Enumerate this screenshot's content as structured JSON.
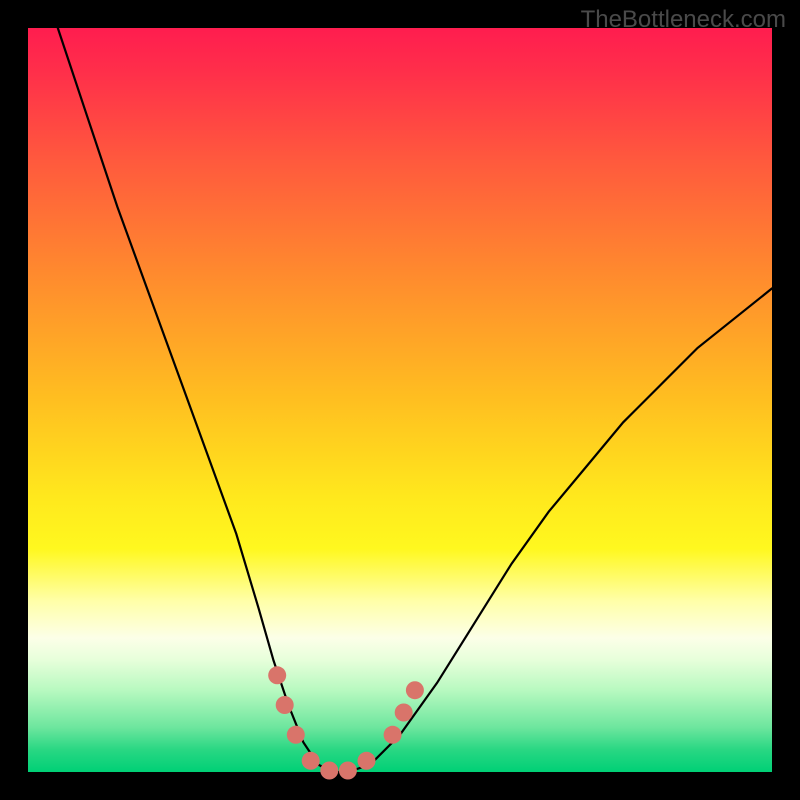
{
  "watermark": "TheBottleneck.com",
  "chart_data": {
    "type": "line",
    "title": "",
    "xlabel": "",
    "ylabel": "",
    "xlim": [
      0,
      100
    ],
    "ylim": [
      0,
      100
    ],
    "series": [
      {
        "name": "curve",
        "x": [
          4,
          8,
          12,
          16,
          20,
          24,
          28,
          31,
          33,
          35,
          37,
          39,
          41,
          43,
          46,
          50,
          55,
          60,
          65,
          70,
          75,
          80,
          85,
          90,
          95,
          100
        ],
        "y": [
          100,
          88,
          76,
          65,
          54,
          43,
          32,
          22,
          15,
          9,
          4,
          1,
          0,
          0,
          1,
          5,
          12,
          20,
          28,
          35,
          41,
          47,
          52,
          57,
          61,
          65
        ]
      }
    ],
    "markers": {
      "name": "highlight-dots",
      "color": "#d9746a",
      "points": [
        {
          "x": 33.5,
          "y": 13
        },
        {
          "x": 34.5,
          "y": 9
        },
        {
          "x": 36,
          "y": 5
        },
        {
          "x": 38,
          "y": 1.5
        },
        {
          "x": 40.5,
          "y": 0.2
        },
        {
          "x": 43,
          "y": 0.2
        },
        {
          "x": 45.5,
          "y": 1.5
        },
        {
          "x": 49,
          "y": 5
        },
        {
          "x": 50.5,
          "y": 8
        },
        {
          "x": 52,
          "y": 11
        }
      ]
    },
    "gradient_stops": [
      {
        "pos": 0.0,
        "color": "#ff1d4f"
      },
      {
        "pos": 0.33,
        "color": "#ff8a2e"
      },
      {
        "pos": 0.63,
        "color": "#ffe81d"
      },
      {
        "pos": 0.82,
        "color": "#fcffe8"
      },
      {
        "pos": 1.0,
        "color": "#00d076"
      }
    ]
  }
}
